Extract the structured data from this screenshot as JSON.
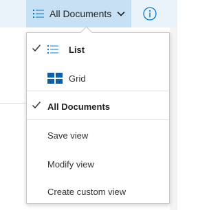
{
  "toolbar": {
    "view_button_label": "All Documents"
  },
  "view_menu": {
    "layout_items": [
      {
        "label": "List",
        "selected": true,
        "icon": "list-icon"
      },
      {
        "label": "Grid",
        "selected": false,
        "icon": "grid-icon"
      }
    ],
    "view_items": [
      {
        "label": "All Documents",
        "selected": true
      }
    ],
    "actions": [
      {
        "label": "Save view"
      },
      {
        "label": "Modify view"
      },
      {
        "label": "Create custom view"
      }
    ]
  },
  "colors": {
    "accent": "#0078d4",
    "button_bg": "#c7e0f4",
    "topbar_bg": "#eaf2fa"
  }
}
